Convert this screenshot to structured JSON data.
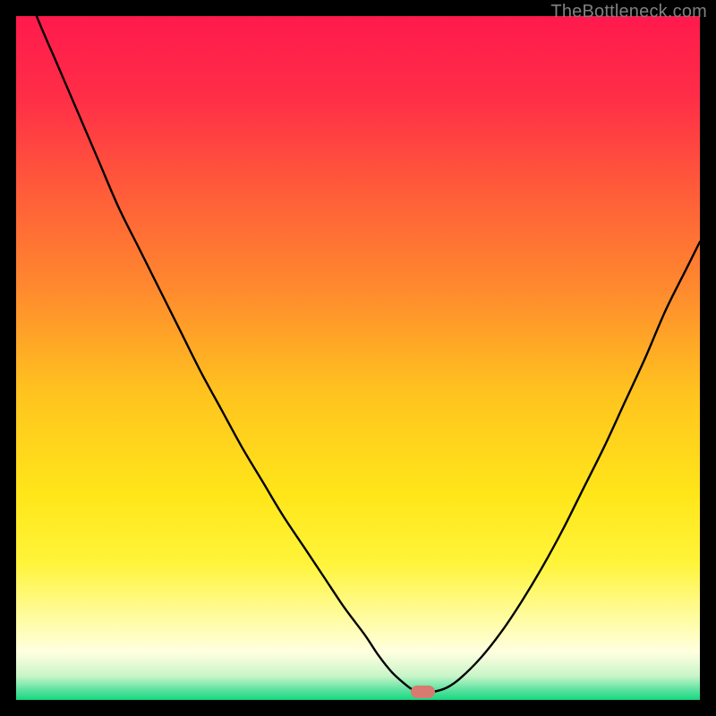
{
  "watermark": "TheBottleneck.com",
  "gradient_stops": [
    {
      "offset": 0.0,
      "color": "#ff1a4d"
    },
    {
      "offset": 0.12,
      "color": "#ff2e47"
    },
    {
      "offset": 0.25,
      "color": "#ff5a3a"
    },
    {
      "offset": 0.4,
      "color": "#ff8a2e"
    },
    {
      "offset": 0.55,
      "color": "#ffc31f"
    },
    {
      "offset": 0.7,
      "color": "#ffe61a"
    },
    {
      "offset": 0.8,
      "color": "#fff43a"
    },
    {
      "offset": 0.88,
      "color": "#fffca0"
    },
    {
      "offset": 0.93,
      "color": "#ffffe0"
    },
    {
      "offset": 0.965,
      "color": "#c9f5c9"
    },
    {
      "offset": 0.985,
      "color": "#5de2a0"
    },
    {
      "offset": 1.0,
      "color": "#17d880"
    }
  ],
  "chart_data": {
    "type": "line",
    "title": "",
    "xlabel": "",
    "ylabel": "",
    "xlim": [
      0,
      100
    ],
    "ylim": [
      0,
      100
    ],
    "x": [
      0,
      3,
      6,
      9,
      12,
      15,
      18,
      21,
      24,
      27,
      30,
      33,
      36,
      39,
      42,
      45,
      48,
      51,
      53,
      55,
      57,
      58,
      59,
      61,
      63,
      65,
      68,
      71,
      74,
      77,
      80,
      83,
      86,
      89,
      92,
      95,
      98,
      100
    ],
    "values": [
      108,
      100,
      93,
      86,
      79,
      72,
      66,
      60,
      54,
      48,
      42.5,
      37,
      32,
      27,
      22.5,
      18,
      13.5,
      9.5,
      6.5,
      4,
      2.2,
      1.5,
      1.2,
      1.2,
      1.8,
      3.2,
      6.2,
      10,
      14.5,
      19.5,
      25,
      31,
      37,
      43.5,
      50,
      57,
      63,
      67
    ],
    "flat_region_x": [
      57.5,
      61.5
    ],
    "flat_region_y": 1.2,
    "marker": {
      "x_center": 59.5,
      "width_pct": 3.5,
      "color": "#d77a6f"
    }
  }
}
